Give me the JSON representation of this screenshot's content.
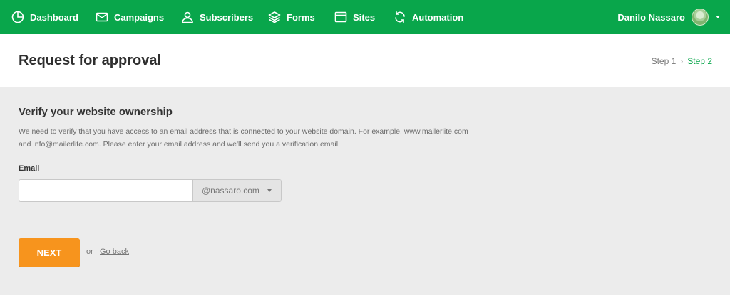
{
  "nav": {
    "items": [
      {
        "label": "Dashboard",
        "icon": "dashboard-icon"
      },
      {
        "label": "Campaigns",
        "icon": "envelope-icon"
      },
      {
        "label": "Subscribers",
        "icon": "user-icon"
      },
      {
        "label": "Forms",
        "icon": "layers-icon"
      },
      {
        "label": "Sites",
        "icon": "browser-window-icon"
      },
      {
        "label": "Automation",
        "icon": "refresh-icon"
      }
    ],
    "user_name": "Danilo Nassaro"
  },
  "header": {
    "title": "Request for approval",
    "step1": "Step 1",
    "step2": "Step 2"
  },
  "main": {
    "section_title": "Verify your website ownership",
    "description": "We need to verify that you have access to an email address that is connected to your website domain. For example, www.mailerlite.com and info@mailerlite.com. Please enter your email address and we'll send you a verification email.",
    "email_label": "Email",
    "email_value": "",
    "domain": "@nassaro.com",
    "next_label": "NEXT",
    "or_text": "or",
    "go_back_label": "Go back"
  },
  "colors": {
    "nav_bg": "#09a64b",
    "accent_green": "#09a64b",
    "button_orange": "#f7941d",
    "page_bg": "#ececec"
  }
}
